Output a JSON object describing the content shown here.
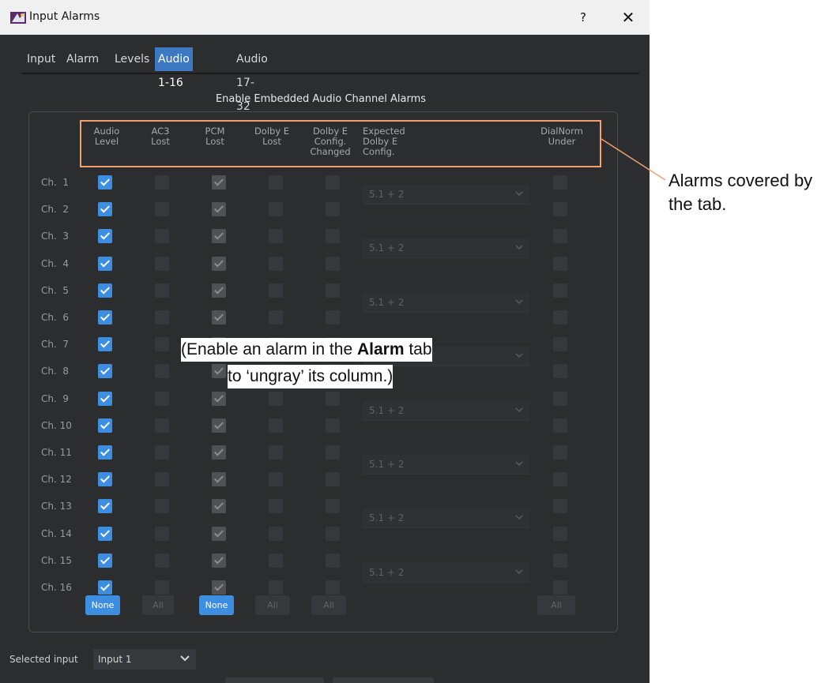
{
  "window": {
    "title": "Input Alarms",
    "help": "?",
    "close": "✕"
  },
  "tabs": [
    {
      "label": "Input"
    },
    {
      "label": "Alarm"
    },
    {
      "label": "Levels"
    },
    {
      "label": "Audio 1-16",
      "active": true
    },
    {
      "label": "Audio 17-32"
    }
  ],
  "section_title": "Enable Embedded Audio Channel Alarms",
  "columns": [
    {
      "lines": [
        "Audio",
        "Level"
      ]
    },
    {
      "lines": [
        "AC3",
        "Lost"
      ]
    },
    {
      "lines": [
        "PCM",
        "Lost"
      ]
    },
    {
      "lines": [
        "Dolby E",
        "Lost"
      ]
    },
    {
      "lines": [
        "Dolby E",
        "Config.",
        "Changed"
      ]
    },
    {
      "lines": [
        "Expected",
        "Dolby E",
        "Config."
      ]
    },
    {
      "lines": [
        "DialNorm",
        "Under"
      ]
    }
  ],
  "channels": [
    "Ch.  1",
    "Ch.  2",
    "Ch.  3",
    "Ch.  4",
    "Ch.  5",
    "Ch.  6",
    "Ch.  7",
    "Ch.  8",
    "Ch.  9",
    "Ch. 10",
    "Ch. 11",
    "Ch. 12",
    "Ch. 13",
    "Ch. 14",
    "Ch. 15",
    "Ch. 16"
  ],
  "checkbox_states": {
    "audio_level": "checked",
    "ac3_lost": "disabled",
    "pcm_lost": "checked-disabled",
    "dolby_e_lost": "disabled",
    "dolby_e_config_changed": "disabled",
    "dialnorm_under": "disabled"
  },
  "expected_config_dropdowns": [
    "5.1 + 2",
    "5.1 + 2",
    "5.1 + 2",
    "",
    "5.1 + 2",
    "5.1 + 2",
    "5.1 + 2",
    "5.1 + 2"
  ],
  "bottom_buttons": [
    {
      "label": "None",
      "style": "active"
    },
    {
      "label": "All",
      "style": "disabled"
    },
    {
      "label": "None",
      "style": "active"
    },
    {
      "label": "All",
      "style": "disabled"
    },
    {
      "label": "All",
      "style": "disabled"
    },
    {
      "label": "All",
      "style": "disabled"
    }
  ],
  "selected_input": {
    "label": "Selected input",
    "value": "Input 1"
  },
  "annotation": {
    "callout": "Alarms covered by the tab.",
    "note_part1": "(Enable an alarm in the ",
    "note_bold": "Alarm",
    "note_part2": " tab",
    "note_line2": "to ‘ungray’ its column.)"
  },
  "colors": {
    "accent": "#3d8ee0",
    "highlight": "#f0a070",
    "window_bg": "#2c2d2f"
  }
}
